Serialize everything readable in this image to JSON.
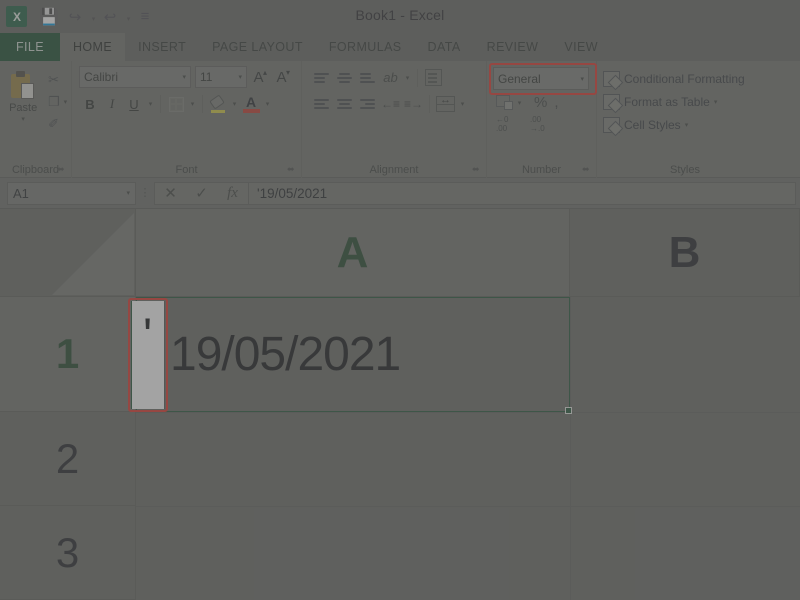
{
  "window": {
    "title": "Book1 - Excel",
    "app_icon": "excel-icon"
  },
  "quick_access": [
    {
      "name": "save-icon",
      "glyph": "💾"
    },
    {
      "name": "redo-icon",
      "glyph": "↪"
    },
    {
      "name": "undo-icon",
      "glyph": "↩"
    },
    {
      "name": "customize-qat-icon",
      "glyph": "≡"
    }
  ],
  "tabs": [
    {
      "label": "FILE",
      "active": false
    },
    {
      "label": "HOME",
      "active": true
    },
    {
      "label": "INSERT",
      "active": false
    },
    {
      "label": "PAGE LAYOUT",
      "active": false
    },
    {
      "label": "FORMULAS",
      "active": false
    },
    {
      "label": "DATA",
      "active": false
    },
    {
      "label": "REVIEW",
      "active": false
    },
    {
      "label": "VIEW",
      "active": false
    }
  ],
  "ribbon": {
    "clipboard": {
      "label": "Clipboard",
      "paste_label": "Paste",
      "cut_glyph": "✂",
      "copy_glyph": "❐",
      "format_painter_glyph": "✐",
      "caret": "▾"
    },
    "font": {
      "label": "Font",
      "font_name": "Calibri",
      "font_size": "11",
      "grow_font": "A",
      "shrink_font": "A",
      "bold": "B",
      "italic": "I",
      "underline": "U",
      "font_color_letter": "A",
      "caret": "▾"
    },
    "alignment": {
      "label": "Alignment",
      "orientation_glyph": "ab",
      "indent_decrease": "←≡",
      "indent_increase": "≡→",
      "caret": "▾"
    },
    "number": {
      "label": "Number",
      "format_value": "General",
      "percent": "%",
      "comma": ",",
      "increase_decimal": ".00\n→.0",
      "decrease_decimal": "←0\n.00",
      "caret": "▾",
      "highlight_color": "#e03127"
    },
    "styles": {
      "label": "Styles",
      "items": [
        {
          "label": "Conditional Formatting",
          "has_caret": false
        },
        {
          "label": "Format as Table",
          "has_caret": true
        },
        {
          "label": "Cell Styles",
          "has_caret": true
        }
      ],
      "caret": "▾"
    },
    "launcher_glyph": "⬌"
  },
  "formula_bar": {
    "name_box_value": "A1",
    "name_box_caret": "▾",
    "cancel_glyph": "✕",
    "enter_glyph": "✓",
    "function_glyph": "fx",
    "value": "'19/05/2021",
    "separator_glyph": "⋮"
  },
  "grid": {
    "columns": [
      {
        "label": "A",
        "selected": true
      },
      {
        "label": "B",
        "selected": false
      }
    ],
    "rows": [
      {
        "label": "1",
        "selected": true
      },
      {
        "label": "2",
        "selected": false
      },
      {
        "label": "3",
        "selected": false
      }
    ],
    "active_cell": "A1",
    "cells": {
      "A1": {
        "apostrophe": "'",
        "display_text": "19/05/2021"
      }
    },
    "highlight_color": "#e03127",
    "selection_color": "#1d5233"
  }
}
